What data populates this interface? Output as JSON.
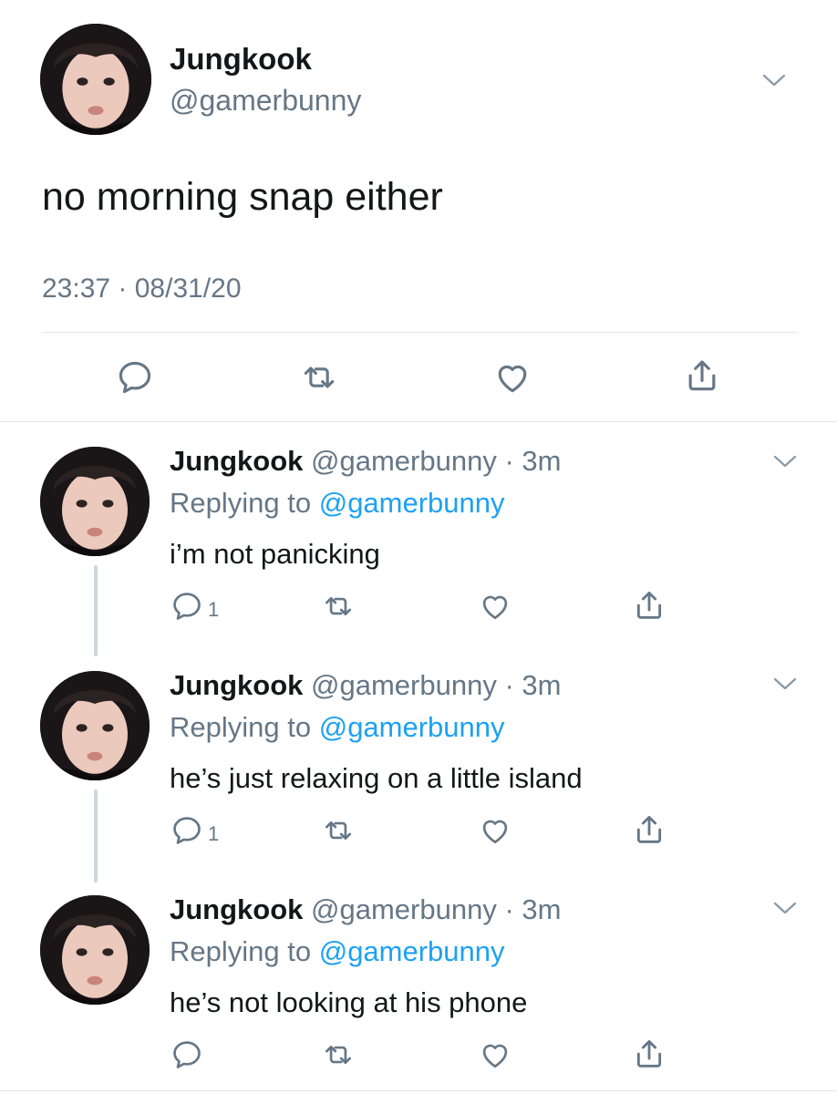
{
  "main_tweet": {
    "name": "Jungkook",
    "handle": "@gamerbunny",
    "text": "no morning snap either",
    "timestamp": "23:37 · 08/31/20"
  },
  "replies": [
    {
      "name": "Jungkook",
      "handle_time": "@gamerbunny · 3m",
      "replying_prefix": "Replying to ",
      "replying_handle": "@gamerbunny",
      "text": "i’m not panicking",
      "reply_count": "1"
    },
    {
      "name": "Jungkook",
      "handle_time": "@gamerbunny · 3m",
      "replying_prefix": "Replying to ",
      "replying_handle": "@gamerbunny",
      "text": "he’s just relaxing on a little island",
      "reply_count": "1"
    },
    {
      "name": "Jungkook",
      "handle_time": "@gamerbunny · 3m",
      "replying_prefix": "Replying to ",
      "replying_handle": "@gamerbunny",
      "text": "he’s not looking at his phone",
      "reply_count": ""
    }
  ],
  "icons": [
    "comment-icon",
    "retweet-icon",
    "like-icon",
    "share-icon",
    "chevron-down-icon"
  ],
  "colors": {
    "text": "#14171a",
    "secondary": "#657786",
    "link": "#1da1f2",
    "divider": "#e1e8ed",
    "thread": "#ccd6dd"
  }
}
